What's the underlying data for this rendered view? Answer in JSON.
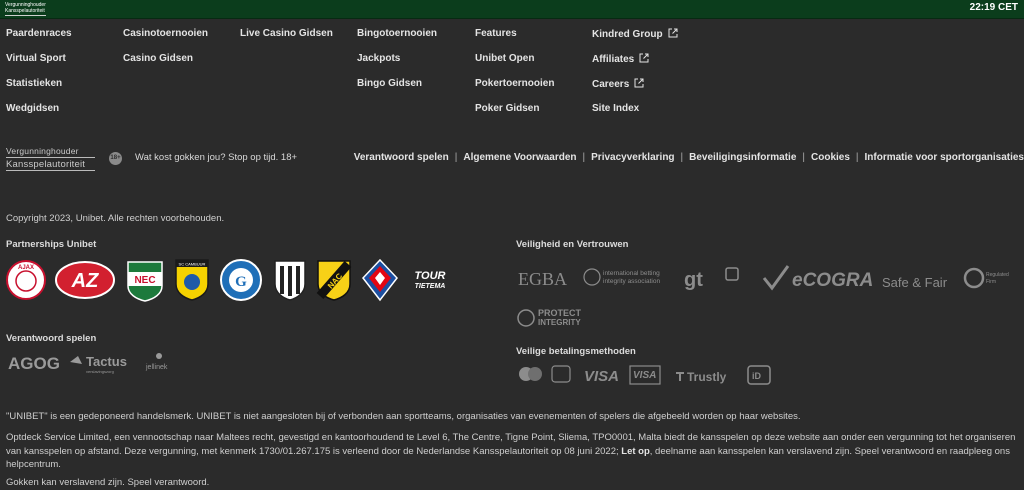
{
  "topbar": {
    "regulator_logo_text": [
      "Vergunninghouder",
      "Kansspelautoriteit"
    ],
    "clock": "22:19 CET"
  },
  "footer_links": {
    "col1": [
      "Paardenraces",
      "Virtual Sport",
      "Statistieken",
      "Wedgidsen"
    ],
    "col2": [
      "Casinotoernooien",
      "Casino Gidsen"
    ],
    "col3": [
      "Live Casino Gidsen"
    ],
    "col4": [
      "Bingotoernooien",
      "Jackpots",
      "Bingo Gidsen"
    ],
    "col5": [
      "Features",
      "Unibet Open",
      "Pokertoernooien",
      "Poker Gidsen"
    ],
    "col6": [
      "Kindred Group",
      "Affiliates",
      "Careers",
      "Site Index"
    ]
  },
  "regulator": {
    "line1": "Vergunninghouder",
    "line2": "Kansspelautoriteit",
    "age_badge": "18+",
    "stop_text": "Wat kost gokken jou? Stop op tijd. 18+"
  },
  "legal_links": [
    "Verantwoord spelen",
    "Algemene Voorwaarden",
    "Privacyverklaring",
    "Beveiligingsinformatie",
    "Cookies",
    "Informatie voor sportorganisaties"
  ],
  "copyright": "Copyright 2023, Unibet. Alle rechten voorbehouden.",
  "partnerships": {
    "title": "Partnerships Unibet",
    "logos": [
      "AFC Ajax",
      "AZ",
      "NEC",
      "SC Cambuur",
      "De Graafschap",
      "Heracles",
      "NAC",
      "Telstar",
      "Tour Tietema"
    ],
    "logo_text": {
      "ajax": "AJAX",
      "az": "AZ",
      "nec": "NEC",
      "cambuur": "SC CAMBUUR",
      "nac": "NAC",
      "tour": "TOUR",
      "tietema": "TIETEMA"
    }
  },
  "trust": {
    "title": "Veiligheid en Vertrouwen",
    "egba": "EGBA",
    "ibia": [
      "international betting",
      "integrity association"
    ],
    "gt": "gt",
    "ecogra": "eCOGRA",
    "safe_fair": "Safe & Fair",
    "regulated": [
      "Regulated",
      "Firm"
    ],
    "protect": [
      "PROTECT",
      "INTEGRITY"
    ]
  },
  "responsible": {
    "title": "Verantwoord spelen",
    "agog": "AGOG",
    "tactus": "Tactus",
    "tactus_sub": "verslavingszorg",
    "jellinek": "jellinek"
  },
  "payments": {
    "title": "Veilige betalingsmethoden",
    "visa": "VISA",
    "visa2": "VISA",
    "trustly": "Trustly",
    "ideal": "iD"
  },
  "disclaimer": {
    "p1": "\"UNIBET\" is een gedeponeerd handelsmerk. UNIBET is niet aangesloten bij of verbonden aan sportteams, organisaties van evenementen of spelers die afgebeeld worden op haar websites.",
    "p2a": "Optdeck Service Limited, een vennootschap naar Maltees recht, gevestigd en kantoorhoudend te Level 6, The Centre, Tigne Point, Sliema, TPO0001, Malta biedt de kansspelen op deze website aan onder een vergunning tot het organiseren van kansspelen op afstand. Deze vergunning, met kenmerk 1730/01.267.175 is verleend door de Nederlandse Kansspelautoriteit op 08 juni 2022; ",
    "p2b": "Let op",
    "p2c": ", deelname aan kansspelen kan verslavend zijn. Speel verantwoord en raadpleeg ons helpcentrum.",
    "p3": "Gokken kan verslavend zijn. Speel verantwoord."
  },
  "colors": {
    "background": "#2b2b2b",
    "topbar": "#0b3d1c",
    "text": "#e4e4e4",
    "muted_logo": "#8c8c8c"
  }
}
